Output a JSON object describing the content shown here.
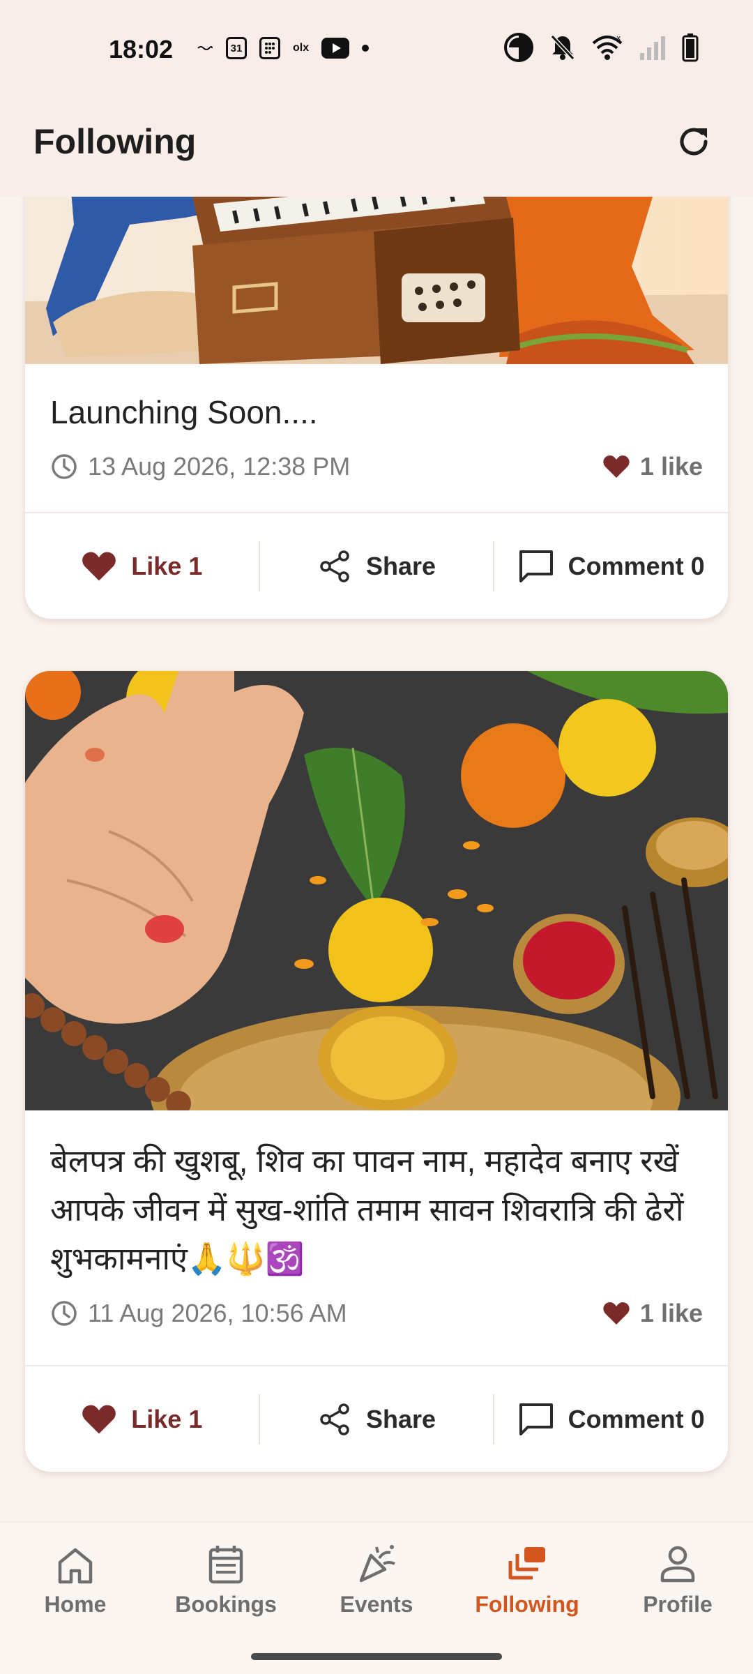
{
  "status_bar": {
    "time": "18:02",
    "left_icons": [
      "notification-icon",
      "calendar-icon",
      "app-icon",
      "olx-icon",
      "youtube-icon",
      "dot-icon"
    ],
    "calendar_text": "31",
    "olx_text": "olx",
    "right_icons": [
      "data-saver-icon",
      "bell-off-icon",
      "wifi-icon",
      "signal-icon",
      "battery-icon"
    ]
  },
  "app_bar": {
    "title": "Following",
    "refresh_icon": "refresh-icon"
  },
  "posts": [
    {
      "image_description": "harmonium-illustration",
      "title": "Launching Soon....",
      "date": "13 Aug 2026, 12:38 PM",
      "likes_text": "1 like",
      "actions": {
        "like": "Like 1",
        "share": "Share",
        "comment": "Comment 0"
      }
    },
    {
      "image_description": "puja-thali-photo",
      "title": "बेलपत्र की खुशबू, शिव का पावन नाम, महादेव बनाए रखें आपके जीवन में सुख-शांति तमाम सावन शिवरात्रि की ढेरों शुभकामनाएं🙏🔱🕉️",
      "date": "11 Aug 2026, 10:56 AM",
      "likes_text": "1 like",
      "actions": {
        "like": "Like 1",
        "share": "Share",
        "comment": "Comment 0"
      }
    }
  ],
  "bottom_nav": {
    "items": [
      {
        "label": "Home",
        "icon": "home-icon"
      },
      {
        "label": "Bookings",
        "icon": "bookings-icon"
      },
      {
        "label": "Events",
        "icon": "events-icon"
      },
      {
        "label": "Following",
        "icon": "following-icon",
        "active": true
      },
      {
        "label": "Profile",
        "icon": "profile-icon"
      }
    ]
  },
  "colors": {
    "accent": "#d2561e",
    "like": "#7b2a2a",
    "background": "#faf2ee"
  }
}
